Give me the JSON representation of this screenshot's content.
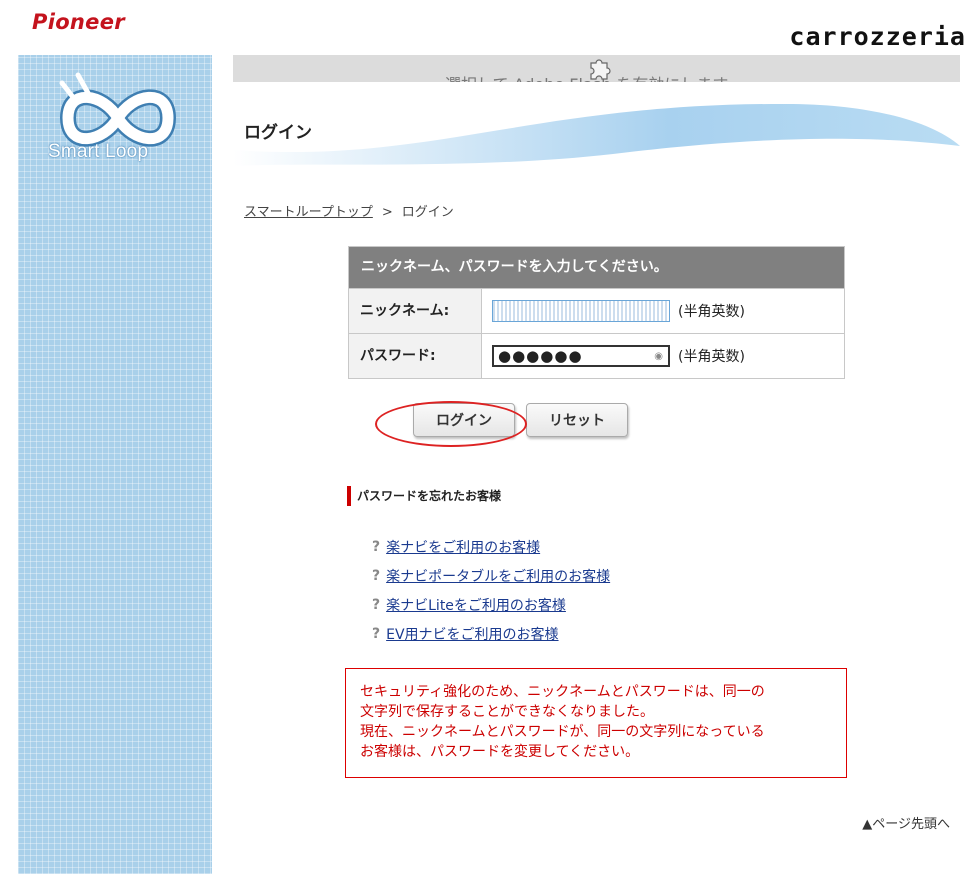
{
  "brand": {
    "pioneer": "Pioneer",
    "carrozzeria": "carrozzeria",
    "smartloop": "Smart Loop"
  },
  "flash": {
    "text": "選択して Adobe Flash を有効にします"
  },
  "page": {
    "title": "ログイン"
  },
  "breadcrumb": {
    "home": "スマートループトップ",
    "separator": ">",
    "current": "ログイン"
  },
  "form": {
    "header": "ニックネーム、パスワードを入力してください。",
    "nickname_label": "ニックネーム:",
    "nickname_value": "",
    "nickname_hint": "(半角英数)",
    "password_label": "パスワード:",
    "password_value": "●●●●●●",
    "password_hint": "(半角英数)",
    "login_button": "ログイン",
    "reset_button": "リセット"
  },
  "forgot": {
    "heading": "パスワードを忘れたお客様",
    "links": [
      "楽ナビをご利用のお客様",
      "楽ナビポータブルをご利用のお客様",
      "楽ナビLiteをご利用のお客様",
      "EV用ナビをご利用のお客様"
    ]
  },
  "notice": {
    "line1": "セキュリティ強化のため、ニックネームとパスワードは、同一の",
    "line2": "文字列で保存することができなくなりました。",
    "line3": "現在、ニックネームとパスワードが、同一の文字列になっている",
    "line4": "お客様は、パスワードを変更してください。"
  },
  "footer": {
    "back_to_top": "▲ページ先頭へ"
  },
  "colors": {
    "brand_red": "#c4131d",
    "sidebar_blue": "#a9d0ea",
    "link": "#1a3a8f",
    "notice_red": "#cc0000"
  }
}
